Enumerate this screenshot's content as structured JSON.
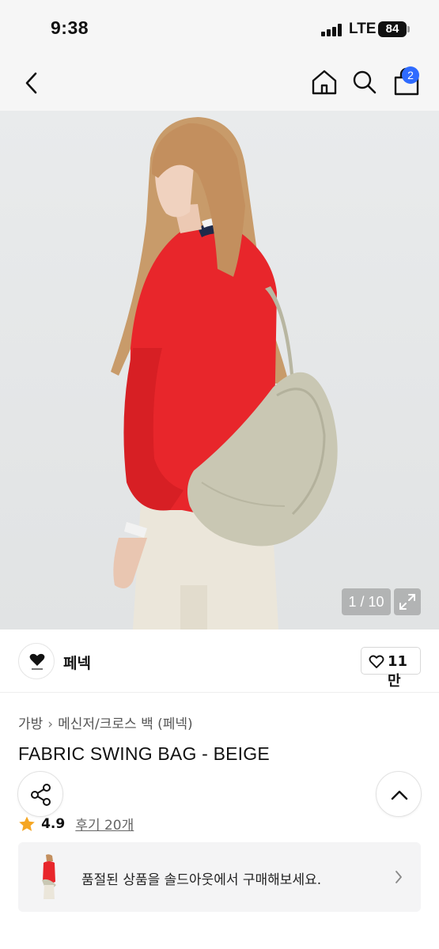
{
  "status_bar": {
    "time": "9:38",
    "network": "LTE",
    "battery": "84"
  },
  "nav": {
    "cart_count": "2",
    "icons": [
      "chevron-left-icon",
      "home-icon",
      "search-icon",
      "shopping-bag-icon"
    ]
  },
  "gallery": {
    "counter": "1 / 10",
    "current_image": 1,
    "total_images": 10
  },
  "brand": {
    "name": "페넥",
    "likes": "11만"
  },
  "product": {
    "breadcrumb": [
      "가방",
      "메신저/크로스 백 (페넥)"
    ],
    "title": "FABRIC SWING BAG - BEIGE",
    "rating": "4.9",
    "reviews": "후기 20개"
  },
  "soldout_banner": {
    "text": "품절된 상품을 솔드아웃에서 구매해보세요."
  },
  "colors": {
    "accent": "#2f6bff",
    "star": "#f5a623",
    "sweater": "#e8262b",
    "bag": "#c9c7b3"
  }
}
